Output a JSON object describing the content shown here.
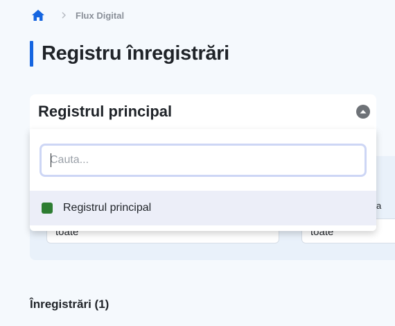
{
  "breadcrumb": {
    "home_icon": "home-icon",
    "separator_icon": "chevron-right-icon",
    "current": "Flux Digital"
  },
  "page": {
    "title": "Registru înregistrări",
    "accent_color": "#1565e0"
  },
  "registry_selector": {
    "selected": "Registrul principal",
    "chevron_icon": "chevron-up-circle-icon",
    "search_placeholder": "Cauta...",
    "search_value": "",
    "options": [
      {
        "label": "Registrul principal",
        "color": "#2e7d32"
      }
    ]
  },
  "filters": {
    "right_label_partial": "ă sta",
    "left_value": "toate",
    "right_value": "toate"
  },
  "records": {
    "heading": "Înregistrări (1)"
  }
}
